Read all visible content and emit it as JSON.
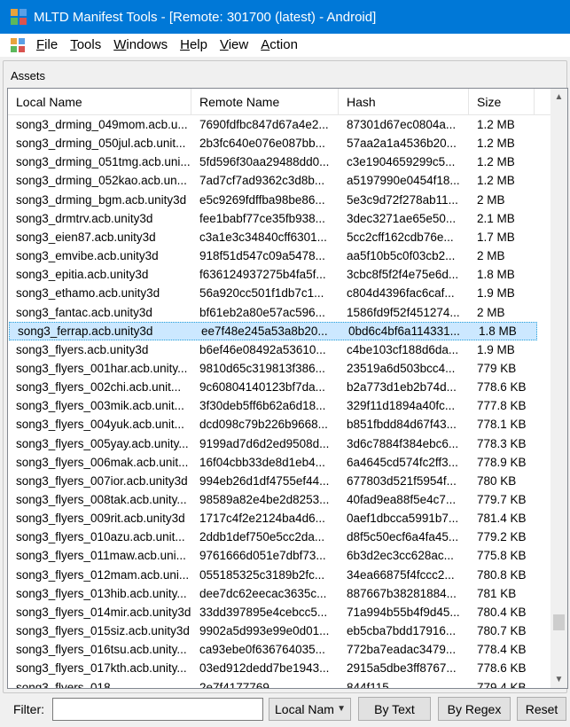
{
  "window": {
    "title": "MLTD Manifest Tools - [Remote: 301700 (latest) - Android]",
    "accent_color": "#0078d7"
  },
  "menu": {
    "items": [
      {
        "label": "File",
        "mnemonic": "F",
        "rest": "ile"
      },
      {
        "label": "Tools",
        "mnemonic": "T",
        "rest": "ools"
      },
      {
        "label": "Windows",
        "mnemonic": "W",
        "rest": "indows"
      },
      {
        "label": "Help",
        "mnemonic": "H",
        "rest": "elp"
      },
      {
        "label": "View",
        "mnemonic": "V",
        "rest": "iew"
      },
      {
        "label": "Action",
        "mnemonic": "A",
        "rest": "ction"
      }
    ]
  },
  "assets": {
    "group_label": "Assets",
    "columns": [
      "Local Name",
      "Remote Name",
      "Hash",
      "Size"
    ],
    "selected_index": 12,
    "rows": [
      [
        "song3_drming_049mom.acb.u...",
        "7690fdfbc847d67a4e2...",
        "87301d67ec0804a...",
        "1.2 MB"
      ],
      [
        "song3_drming_050jul.acb.unit...",
        "2b3fc640e076e087bb...",
        "57aa2a1a4536b20...",
        "1.2 MB"
      ],
      [
        "song3_drming_051tmg.acb.uni...",
        "5fd596f30aa29488dd0...",
        "c3e1904659299c5...",
        "1.2 MB"
      ],
      [
        "song3_drming_052kao.acb.un...",
        "7ad7cf7ad9362c3d8b...",
        "a5197990e0454f18...",
        "1.2 MB"
      ],
      [
        "song3_drming_bgm.acb.unity3d",
        "e5c9269fdffba98be86...",
        "5e3c9d72f278ab11...",
        "2 MB"
      ],
      [
        "song3_drmtrv.acb.unity3d",
        "fee1babf77ce35fb938...",
        "3dec3271ae65e50...",
        "2.1 MB"
      ],
      [
        "song3_eien87.acb.unity3d",
        "c3a1e3c34840cff6301...",
        "5cc2cff162cdb76e...",
        "1.7 MB"
      ],
      [
        "song3_emvibe.acb.unity3d",
        "918f51d547c09a5478...",
        "aa5f10b5c0f03cb2...",
        "2 MB"
      ],
      [
        "song3_epitia.acb.unity3d",
        "f636124937275b4fa5f...",
        "3cbc8f5f2f4e75e6d...",
        "1.8 MB"
      ],
      [
        "song3_ethamo.acb.unity3d",
        "56a920cc501f1db7c1...",
        "c804d4396fac6caf...",
        "1.9 MB"
      ],
      [
        "song3_fantac.acb.unity3d",
        "bf61eb2a80e57ac596...",
        "1586fd9f52f451274...",
        "2 MB"
      ],
      [
        "song3_ferrap.acb.unity3d",
        "ee7f48e245a53a8b20...",
        "0bd6c4bf6a114331...",
        "1.8 MB"
      ],
      [
        "song3_flyers.acb.unity3d",
        "b6ef46e08492a53610...",
        "c4be103cf188d6da...",
        "1.9 MB"
      ],
      [
        "song3_flyers_001har.acb.unity...",
        "9810d65c319813f386...",
        "23519a6d503bcc4...",
        "779 KB"
      ],
      [
        "song3_flyers_002chi.acb.unit...",
        "9c60804140123bf7da...",
        "b2a773d1eb2b74d...",
        "778.6 KB"
      ],
      [
        "song3_flyers_003mik.acb.unit...",
        "3f30deb5ff6b62a6d18...",
        "329f11d1894a40fc...",
        "777.8 KB"
      ],
      [
        "song3_flyers_004yuk.acb.unit...",
        "dcd098c79b226b9668...",
        "b851fbdd84d67f43...",
        "778.1 KB"
      ],
      [
        "song3_flyers_005yay.acb.unity...",
        "9199ad7d6d2ed9508d...",
        "3d6c7884f384ebc6...",
        "778.3 KB"
      ],
      [
        "song3_flyers_006mak.acb.unit...",
        "16f04cbb33de8d1eb4...",
        "6a4645cd574fc2ff3...",
        "778.9 KB"
      ],
      [
        "song3_flyers_007ior.acb.unity3d",
        "994eb26d1df4755ef44...",
        "677803d521f5954f...",
        "780 KB"
      ],
      [
        "song3_flyers_008tak.acb.unity...",
        "98589a82e4be2d8253...",
        "40fad9ea88f5e4c7...",
        "779.7 KB"
      ],
      [
        "song3_flyers_009rit.acb.unity3d",
        "1717c4f2e2124ba4d6...",
        "0aef1dbcca5991b7...",
        "781.4 KB"
      ],
      [
        "song3_flyers_010azu.acb.unit...",
        "2ddb1def750e5cc2da...",
        "d8f5c50ecf6a4fa45...",
        "779.2 KB"
      ],
      [
        "song3_flyers_011maw.acb.uni...",
        "9761666d051e7dbf73...",
        "6b3d2ec3cc628ac...",
        "775.8 KB"
      ],
      [
        "song3_flyers_012mam.acb.uni...",
        "055185325c3189b2fc...",
        "34ea66875f4fccc2...",
        "780.8 KB"
      ],
      [
        "song3_flyers_013hib.acb.unity...",
        "dee7dc62eecac3635c...",
        "887667b38281884...",
        "781 KB"
      ],
      [
        "song3_flyers_014mir.acb.unity3d",
        "33dd397895e4cebcc5...",
        "71a994b55b4f9d45...",
        "780.4 KB"
      ],
      [
        "song3_flyers_015siz.acb.unity3d",
        "9902a5d993e99e0d01...",
        "eb5cba7bdd17916...",
        "780.7 KB"
      ],
      [
        "song3_flyers_016tsu.acb.unity...",
        "ca93ebe0f636764035...",
        "772ba7eadac3479...",
        "778.4 KB"
      ],
      [
        "song3_flyers_017kth.acb.unity...",
        "03ed912dedd7be1943...",
        "2915a5dbe3ff8767...",
        "778.6 KB"
      ],
      [
        "song3_flyers_018...",
        "2e7f4177769...",
        "844f115...",
        "779.4 KB"
      ]
    ]
  },
  "filter": {
    "label": "Filter:",
    "value": "",
    "column_selected": "Local Nam",
    "by_text_label": "By Text",
    "by_regex_label": "By Regex",
    "reset_label": "Reset"
  }
}
